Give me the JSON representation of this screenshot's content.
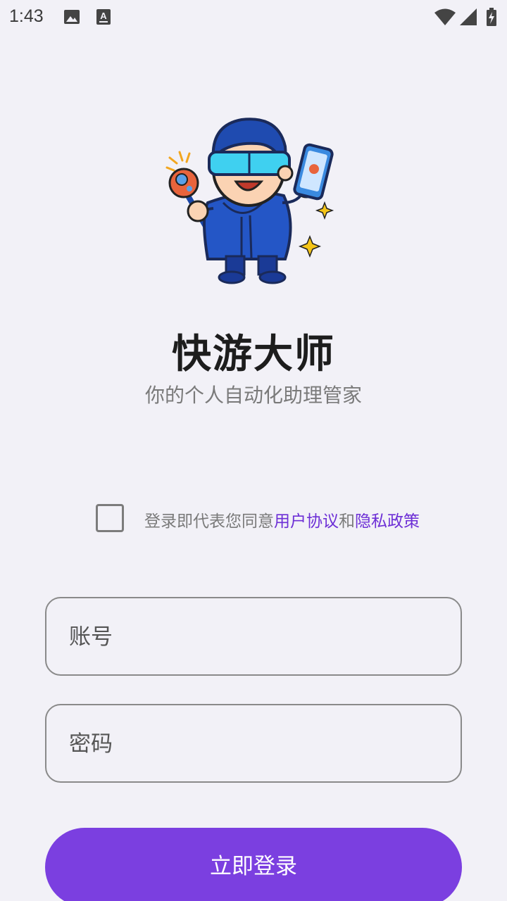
{
  "status_bar": {
    "time": "1:43",
    "icons": [
      "gallery-icon",
      "text-a-icon",
      "wifi-icon",
      "signal-icon",
      "battery-charging-icon"
    ]
  },
  "app": {
    "title": "快游大师",
    "subtitle": "你的个人自动化助理管家"
  },
  "agreement": {
    "prefix": "登录即代表您同意",
    "user_agreement": "用户协议",
    "and": "和",
    "privacy_policy": "隐私政策",
    "checked": false
  },
  "form": {
    "account_placeholder": "账号",
    "password_placeholder": "密码",
    "login_label": "立即登录"
  },
  "colors": {
    "accent": "#7b3fe0",
    "link": "#6d2fd6",
    "background": "#f2f1f7"
  }
}
